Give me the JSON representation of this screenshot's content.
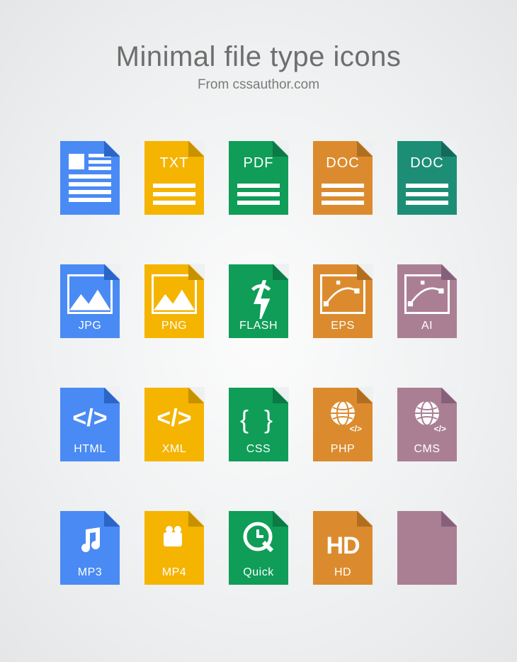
{
  "header": {
    "title": "Minimal file type icons",
    "subtitle": "From cssauthor.com"
  },
  "colors": {
    "blue": "#4a8af4",
    "yellow": "#f4b400",
    "green": "#0f9d58",
    "orange": "#db8b2e",
    "teal": "#1d8e76",
    "mauve": "#aa7f94"
  },
  "icons": [
    {
      "id": "generic-doc",
      "label": "",
      "color": "blue",
      "style": "doclines"
    },
    {
      "id": "txt",
      "label": "TXT",
      "color": "yellow",
      "style": "textdoc"
    },
    {
      "id": "pdf",
      "label": "PDF",
      "color": "green",
      "style": "textdoc"
    },
    {
      "id": "doc-orange",
      "label": "DOC",
      "color": "orange",
      "style": "textdoc"
    },
    {
      "id": "doc-teal",
      "label": "DOC",
      "color": "teal",
      "style": "textdoc"
    },
    {
      "id": "jpg",
      "label": "JPG",
      "color": "blue",
      "style": "image"
    },
    {
      "id": "png",
      "label": "PNG",
      "color": "yellow",
      "style": "image"
    },
    {
      "id": "flash",
      "label": "FLASH",
      "color": "green",
      "style": "flash"
    },
    {
      "id": "eps",
      "label": "EPS",
      "color": "orange",
      "style": "vector"
    },
    {
      "id": "ai",
      "label": "AI",
      "color": "mauve",
      "style": "vector"
    },
    {
      "id": "html",
      "label": "HTML",
      "color": "blue",
      "style": "code-angle"
    },
    {
      "id": "xml",
      "label": "XML",
      "color": "yellow",
      "style": "code-angle"
    },
    {
      "id": "css",
      "label": "CSS",
      "color": "green",
      "style": "code-curly"
    },
    {
      "id": "php",
      "label": "PHP",
      "color": "orange",
      "style": "globe-code"
    },
    {
      "id": "cms",
      "label": "CMS",
      "color": "mauve",
      "style": "globe-code"
    },
    {
      "id": "mp3",
      "label": "MP3",
      "color": "blue",
      "style": "music"
    },
    {
      "id": "mp4",
      "label": "MP4",
      "color": "yellow",
      "style": "video"
    },
    {
      "id": "quick",
      "label": "Quick",
      "color": "green",
      "style": "quicktime"
    },
    {
      "id": "hd",
      "label": "HD",
      "color": "orange",
      "style": "hd"
    },
    {
      "id": "blank",
      "label": "",
      "color": "mauve",
      "style": "blank"
    }
  ]
}
